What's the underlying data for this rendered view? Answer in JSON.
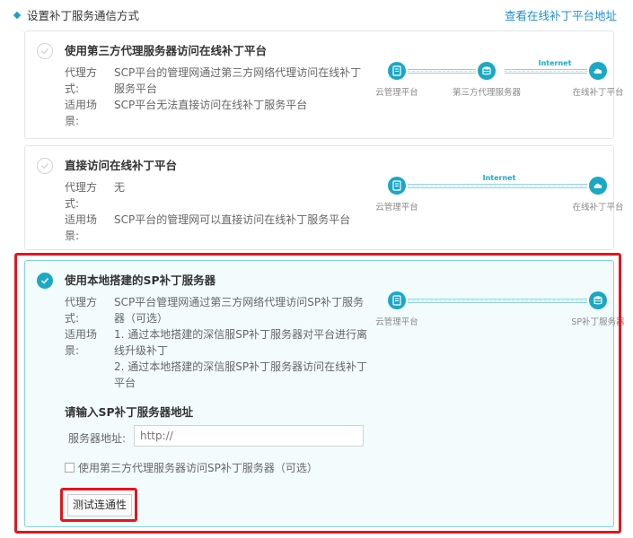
{
  "header": {
    "title": "设置补丁服务通信方式",
    "link": "查看在线补丁平台地址"
  },
  "options": [
    {
      "title": "使用第三方代理服务器访问在线补丁平台",
      "proxy_key": "代理方式:",
      "proxy_value": "SCP平台的管理网通过第三方网络代理访问在线补丁服务平台",
      "scene_key": "适用场景:",
      "scene_value": "SCP平台无法直接访问在线补丁服务平台",
      "selected": false,
      "diagram": {
        "nodes": [
          "云管理平台",
          "第三方代理服务器",
          "在线补丁平台"
        ],
        "internet": "Internet"
      }
    },
    {
      "title": "直接访问在线补丁平台",
      "proxy_key": "代理方式:",
      "proxy_value": "无",
      "scene_key": "适用场景:",
      "scene_value": "SCP平台的管理网可以直接访问在线补丁服务平台",
      "selected": false,
      "diagram": {
        "nodes": [
          "云管理平台",
          "在线补丁平台"
        ],
        "internet": "Internet"
      }
    },
    {
      "title": "使用本地搭建的SP补丁服务器",
      "proxy_key": "代理方式:",
      "proxy_value": "SCP平台管理网通过第三方网络代理访问SP补丁服务器（可选）",
      "scene_key": "适用场景:",
      "scene_value_1": "1. 通过本地搭建的深信服SP补丁服务器对平台进行离线升级补丁",
      "scene_value_2": "2. 通过本地搭建的深信服SP补丁服务器访问在线补丁平台",
      "selected": true,
      "diagram": {
        "nodes": [
          "云管理平台",
          "SP补丁服务器"
        ]
      }
    }
  ],
  "sp_form": {
    "title": "请输入SP补丁服务器地址",
    "address_label": "服务器地址:",
    "address_placeholder": "http://",
    "address_value": "",
    "proxy_checkbox_label": "使用第三方代理服务器访问SP补丁服务器（可选）",
    "proxy_checkbox_checked": false,
    "test_button": "测试连通性"
  },
  "colors": {
    "accent": "#1ba8c4",
    "link": "#1e8dd6",
    "highlight": "#e8141c",
    "selected_bg": "#f2fcfd"
  },
  "icons": {
    "platform": "server-rack-icon",
    "proxy": "database-icon",
    "cloud": "cloud-icon",
    "check": "check-icon",
    "diamond": "diamond-bullet-icon"
  }
}
